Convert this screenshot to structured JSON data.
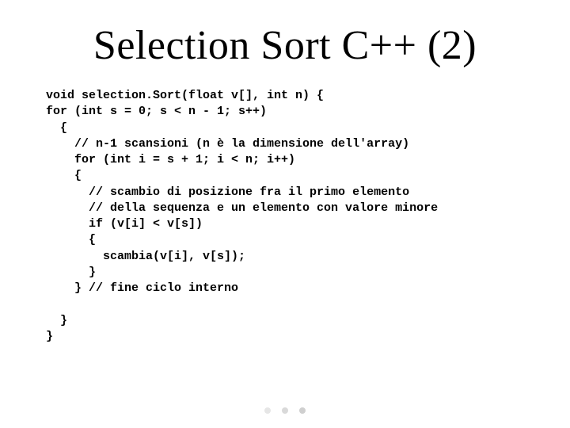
{
  "title": "Selection Sort C++ (2)",
  "code_lines": [
    "void selection.Sort(float v[], int n) {",
    "for (int s = 0; s < n - 1; s++)",
    "  {",
    "    // n-1 scansioni (n è la dimensione dell'array)",
    "    for (int i = s + 1; i < n; i++)",
    "    {",
    "      // scambio di posizione fra il primo elemento",
    "      // della sequenza e un elemento con valore minore",
    "      if (v[i] < v[s])",
    "      {",
    "        scambia(v[i], v[s]);",
    "      }",
    "    } // fine ciclo interno",
    "",
    "  }",
    "}"
  ]
}
